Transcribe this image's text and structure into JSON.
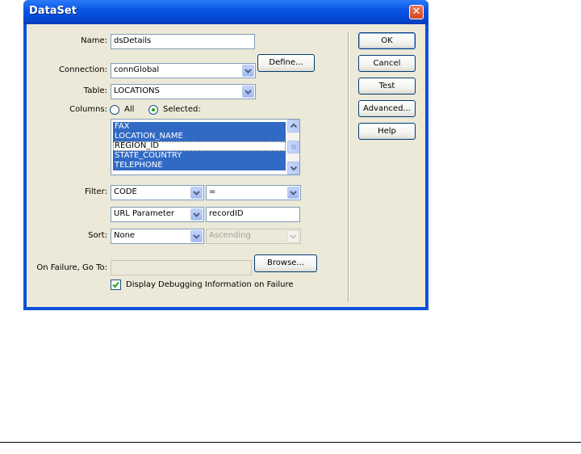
{
  "window": {
    "title": "DataSet"
  },
  "form": {
    "name": {
      "label": "Name:",
      "value": "dsDetails"
    },
    "connection": {
      "label": "Connection:",
      "value": "connGlobal",
      "define_label": "Define..."
    },
    "table": {
      "label": "Table:",
      "value": "LOCATIONS"
    },
    "columns": {
      "label": "Columns:",
      "all_label": "All",
      "selected_label": "Selected:",
      "selected_option": "Selected",
      "items": [
        {
          "text": "FAX",
          "selected": true
        },
        {
          "text": "LOCATION_NAME",
          "selected": true
        },
        {
          "text": "REGION_ID",
          "selected": false
        },
        {
          "text": "STATE_COUNTRY",
          "selected": true
        },
        {
          "text": "TELEPHONE",
          "selected": true
        }
      ]
    },
    "filter": {
      "label": "Filter:",
      "column": "CODE",
      "operator": "=",
      "source": "URL Parameter",
      "value": "recordID"
    },
    "sort": {
      "label": "Sort:",
      "column": "None",
      "direction": "Ascending"
    },
    "on_failure": {
      "label": "On Failure, Go To:",
      "value": "",
      "browse_label": "Browse..."
    },
    "debug": {
      "label": "Display Debugging Information on Failure",
      "checked": true
    }
  },
  "side_buttons": {
    "ok": "OK",
    "cancel": "Cancel",
    "test": "Test",
    "advanced": "Advanced...",
    "help": "Help"
  },
  "icons": {
    "close": "close-icon",
    "dropdown": "chevron-down-icon",
    "check": "checkmark-icon"
  },
  "colors": {
    "title_bar": "#0a56e6",
    "dialog_face": "#ece9d8",
    "selection": "#316ac5",
    "close_button": "#d2461f"
  }
}
